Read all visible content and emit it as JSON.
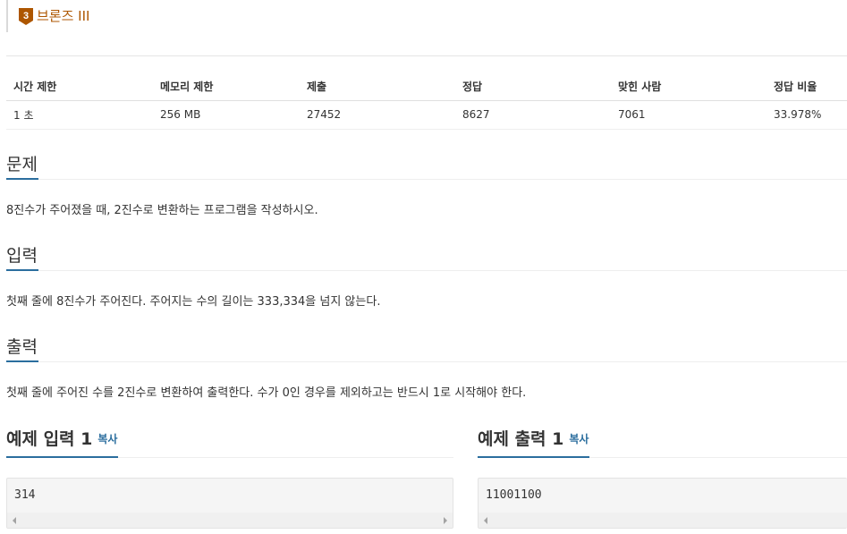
{
  "tier": {
    "badge_number": "3",
    "label": "브론즈 III",
    "color": "#ad5600"
  },
  "stats": {
    "headers": [
      "시간 제한",
      "메모리 제한",
      "제출",
      "정답",
      "맞힌 사람",
      "정답 비율"
    ],
    "values": [
      "1 초",
      "256 MB",
      "27452",
      "8627",
      "7061",
      "33.978%"
    ]
  },
  "problem": {
    "title": "문제",
    "body": "8진수가 주어졌을 때, 2진수로 변환하는 프로그램을 작성하시오."
  },
  "input": {
    "title": "입력",
    "body": "첫째 줄에 8진수가 주어진다. 주어지는 수의 길이는 333,334을 넘지 않는다."
  },
  "output": {
    "title": "출력",
    "body": "첫째 줄에 주어진 수를 2진수로 변환하여 출력한다. 수가 0인 경우를 제외하고는 반드시 1로 시작해야 한다."
  },
  "sample_input": {
    "title": "예제 입력 1",
    "copy_label": "복사",
    "content": "314"
  },
  "sample_output": {
    "title": "예제 출력 1",
    "copy_label": "복사",
    "content": "11001100"
  },
  "colors": {
    "accent": "#2b6e9e",
    "tier": "#ad5600"
  }
}
